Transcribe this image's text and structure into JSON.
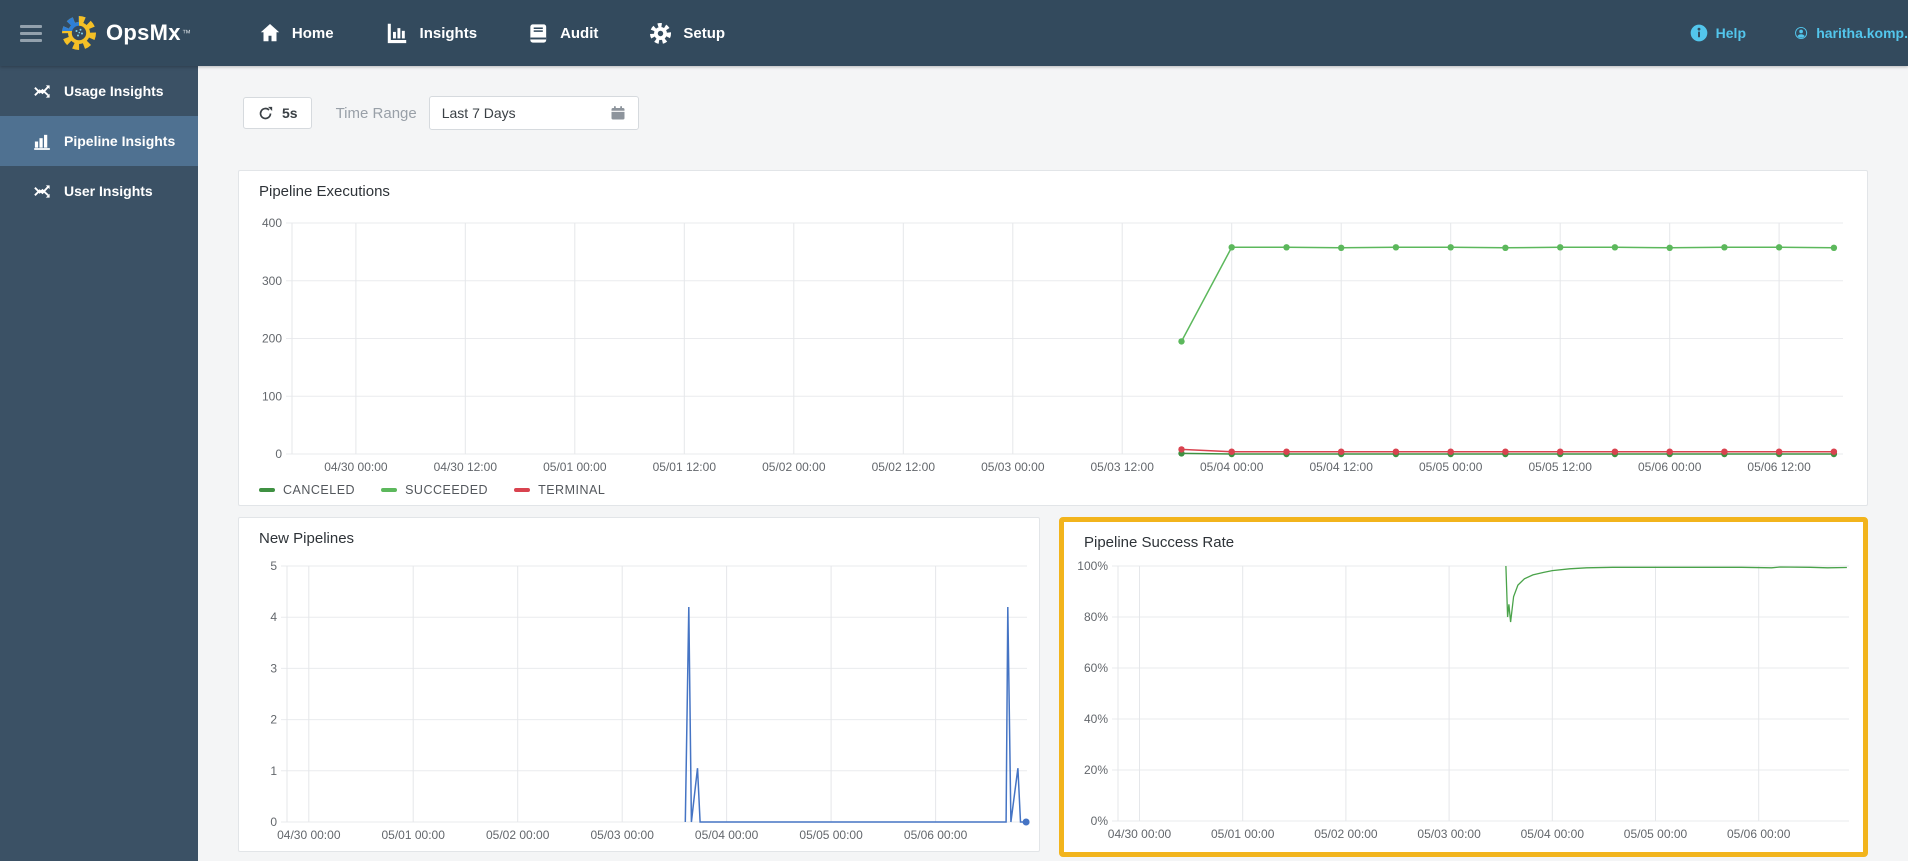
{
  "topbar": {
    "logo_text": "OpsMx",
    "trademark": "™",
    "nav": [
      {
        "label": "Home"
      },
      {
        "label": "Insights"
      },
      {
        "label": "Audit"
      },
      {
        "label": "Setup"
      }
    ],
    "help_label": "Help",
    "username": "haritha.komp."
  },
  "sidebar": {
    "items": [
      {
        "label": "Usage Insights",
        "selected": false
      },
      {
        "label": "Pipeline Insights",
        "selected": true
      },
      {
        "label": "User Insights",
        "selected": false
      }
    ]
  },
  "toolbar": {
    "refresh_interval": "5s",
    "time_range_label": "Time Range",
    "time_range_value": "Last 7 Days"
  },
  "colors": {
    "topbar": "#334a5d",
    "sidebar": "#3b5165",
    "sidebar_selected": "#4f7191",
    "accent": "#53c6ec",
    "highlight_border": "#f2b41c",
    "canceled": "#3f9142",
    "succeeded": "#5cb85c",
    "terminal": "#d9434f",
    "new_pipelines_line": "#4574c4",
    "success_line": "#4aa34a"
  },
  "chart_data": [
    {
      "type": "line",
      "title": "Pipeline Executions",
      "x_unit": "hours since 04/30 00:00",
      "xlim": [
        -7,
        163
      ],
      "ylim": [
        0,
        400
      ],
      "yticks": [
        {
          "v": 0,
          "label": "0"
        },
        {
          "v": 100,
          "label": "100"
        },
        {
          "v": 200,
          "label": "200"
        },
        {
          "v": 300,
          "label": "300"
        },
        {
          "v": 400,
          "label": "400"
        }
      ],
      "xticks": [
        {
          "v": 0,
          "label": "04/30 00:00"
        },
        {
          "v": 12,
          "label": "04/30 12:00"
        },
        {
          "v": 24,
          "label": "05/01 00:00"
        },
        {
          "v": 36,
          "label": "05/01 12:00"
        },
        {
          "v": 48,
          "label": "05/02 00:00"
        },
        {
          "v": 60,
          "label": "05/02 12:00"
        },
        {
          "v": 72,
          "label": "05/03 00:00"
        },
        {
          "v": 84,
          "label": "05/03 12:00"
        },
        {
          "v": 96,
          "label": "05/04 00:00"
        },
        {
          "v": 108,
          "label": "05/04 12:00"
        },
        {
          "v": 120,
          "label": "05/05 00:00"
        },
        {
          "v": 132,
          "label": "05/05 12:00"
        },
        {
          "v": 144,
          "label": "05/06 00:00"
        },
        {
          "v": 156,
          "label": "05/06 12:00"
        }
      ],
      "series": [
        {
          "name": "CANCELED",
          "color": "#3f9142",
          "width": 1.5,
          "markers": true,
          "points": [
            [
              90.5,
              1
            ],
            [
              96,
              0
            ],
            [
              102,
              0
            ],
            [
              108,
              0
            ],
            [
              114,
              0
            ],
            [
              120,
              0
            ],
            [
              126,
              0
            ],
            [
              132,
              0
            ],
            [
              138,
              0
            ],
            [
              144,
              0
            ],
            [
              150,
              0
            ],
            [
              156,
              0
            ],
            [
              162,
              0
            ]
          ]
        },
        {
          "name": "TERMINAL",
          "color": "#d9434f",
          "width": 1.5,
          "markers": true,
          "points": [
            [
              90.5,
              8
            ],
            [
              96,
              4
            ],
            [
              102,
              4
            ],
            [
              108,
              4
            ],
            [
              114,
              4
            ],
            [
              120,
              4
            ],
            [
              126,
              4
            ],
            [
              132,
              4
            ],
            [
              138,
              4
            ],
            [
              144,
              4
            ],
            [
              150,
              4
            ],
            [
              156,
              4
            ],
            [
              162,
              4
            ]
          ]
        },
        {
          "name": "SUCCEEDED",
          "color": "#5cb85c",
          "width": 1.5,
          "markers": true,
          "points": [
            [
              90.5,
              195
            ],
            [
              96,
              358
            ],
            [
              102,
              358
            ],
            [
              108,
              357
            ],
            [
              114,
              358
            ],
            [
              120,
              358
            ],
            [
              126,
              357
            ],
            [
              132,
              358
            ],
            [
              138,
              358
            ],
            [
              144,
              357
            ],
            [
              150,
              358
            ],
            [
              156,
              358
            ],
            [
              162,
              357
            ]
          ]
        }
      ],
      "legend": [
        {
          "label": "CANCELED",
          "color": "#3f9142"
        },
        {
          "label": "SUCCEEDED",
          "color": "#5cb85c"
        },
        {
          "label": "TERMINAL",
          "color": "#d9434f"
        }
      ],
      "grid": true,
      "legend_position": "bottom-left"
    },
    {
      "type": "line",
      "title": "New Pipelines",
      "x_unit": "hours since 04/30 00:00",
      "xlim": [
        -5,
        165
      ],
      "ylim": [
        0,
        5
      ],
      "yticks": [
        {
          "v": 0,
          "label": "0"
        },
        {
          "v": 1,
          "label": "1"
        },
        {
          "v": 2,
          "label": "2"
        },
        {
          "v": 3,
          "label": "3"
        },
        {
          "v": 4,
          "label": "4"
        },
        {
          "v": 5,
          "label": "5"
        }
      ],
      "xticks": [
        {
          "v": 0,
          "label": "04/30 00:00"
        },
        {
          "v": 24,
          "label": "05/01 00:00"
        },
        {
          "v": 48,
          "label": "05/02 00:00"
        },
        {
          "v": 72,
          "label": "05/03 00:00"
        },
        {
          "v": 96,
          "label": "05/04 00:00"
        },
        {
          "v": 120,
          "label": "05/05 00:00"
        },
        {
          "v": 144,
          "label": "05/06 00:00"
        }
      ],
      "series": [
        {
          "name": "New Pipelines",
          "color": "#4574c4",
          "width": 1.5,
          "markers": "last",
          "points": [
            [
              86.5,
              0
            ],
            [
              87.3,
              4.2
            ],
            [
              87.9,
              0
            ],
            [
              89.3,
              1.05
            ],
            [
              89.9,
              0
            ],
            [
              120,
              0
            ],
            [
              160.2,
              0
            ],
            [
              160.6,
              4.2
            ],
            [
              161.3,
              0
            ],
            [
              162.9,
              1.05
            ],
            [
              163.5,
              0
            ],
            [
              164.8,
              0
            ]
          ]
        }
      ],
      "grid": true
    },
    {
      "type": "line",
      "title": "Pipeline Success Rate",
      "x_unit": "hours since 04/30 00:00",
      "xlim": [
        -5,
        165
      ],
      "ylim": [
        0,
        100
      ],
      "yticks": [
        {
          "v": 0,
          "label": "0%"
        },
        {
          "v": 20,
          "label": "20%"
        },
        {
          "v": 40,
          "label": "40%"
        },
        {
          "v": 60,
          "label": "60%"
        },
        {
          "v": 80,
          "label": "80%"
        },
        {
          "v": 100,
          "label": "100%"
        }
      ],
      "xticks": [
        {
          "v": 0,
          "label": "04/30 00:00"
        },
        {
          "v": 24,
          "label": "05/01 00:00"
        },
        {
          "v": 48,
          "label": "05/02 00:00"
        },
        {
          "v": 72,
          "label": "05/03 00:00"
        },
        {
          "v": 96,
          "label": "05/04 00:00"
        },
        {
          "v": 120,
          "label": "05/05 00:00"
        },
        {
          "v": 144,
          "label": "05/06 00:00"
        }
      ],
      "series": [
        {
          "name": "Success Rate",
          "color": "#4aa34a",
          "width": 1.3,
          "markers": false,
          "points": [
            [
              85.2,
              100
            ],
            [
              85.6,
              80
            ],
            [
              85.9,
              85
            ],
            [
              86.3,
              78
            ],
            [
              87,
              88
            ],
            [
              88,
              92.5
            ],
            [
              89.5,
              95
            ],
            [
              91.5,
              96.5
            ],
            [
              94,
              97.5
            ],
            [
              96,
              98.2
            ],
            [
              100,
              98.9
            ],
            [
              104,
              99.3
            ],
            [
              110,
              99.5
            ],
            [
              120,
              99.5
            ],
            [
              130,
              99.5
            ],
            [
              140,
              99.5
            ],
            [
              147,
              99.3
            ],
            [
              149,
              99.6
            ],
            [
              156,
              99.5
            ],
            [
              160,
              99.3
            ],
            [
              164.5,
              99.4
            ]
          ]
        }
      ],
      "grid": true,
      "highlighted": true
    }
  ]
}
